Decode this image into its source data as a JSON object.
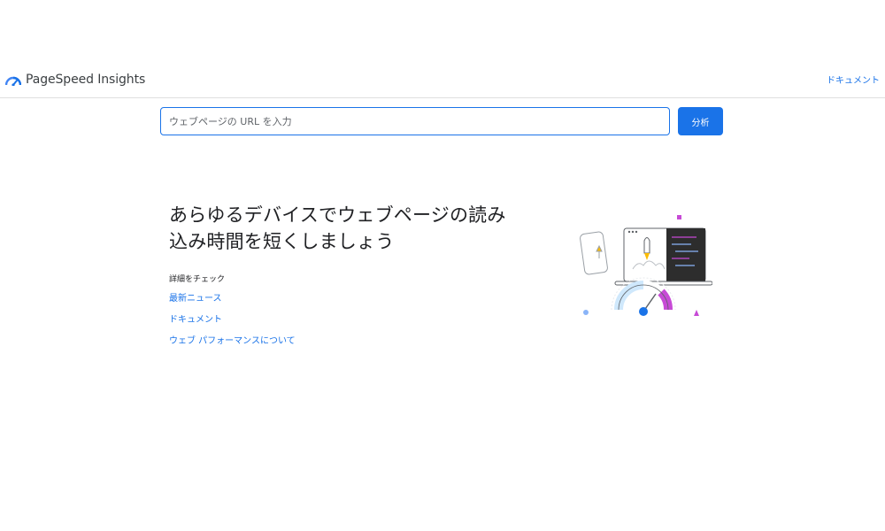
{
  "header": {
    "app_name": "PageSpeed Insights",
    "docs_link": "ドキュメント"
  },
  "search": {
    "placeholder": "ウェブページの URL を入力",
    "value": "",
    "analyze_label": "分析"
  },
  "hero": {
    "title_line1": "あらゆるデバイスでウェブページの読み",
    "title_line2": "込み時間を短くしましょう",
    "learn_more_heading": "詳細をチェック",
    "links": [
      {
        "label": "最新ニュース"
      },
      {
        "label": "ドキュメント"
      },
      {
        "label": "ウェブ パフォーマンスについて"
      }
    ]
  },
  "colors": {
    "accent": "#1a73e8",
    "text": "#202124",
    "divider": "#e0e0e0",
    "illustration_purple": "#c74ad6",
    "illustration_blue": "#4285f4",
    "illustration_dark": "#2d2d2d"
  },
  "icons": {
    "logo": "pagespeed-gauge-icon",
    "illustration": "devices-speed-gauge-illustration"
  }
}
